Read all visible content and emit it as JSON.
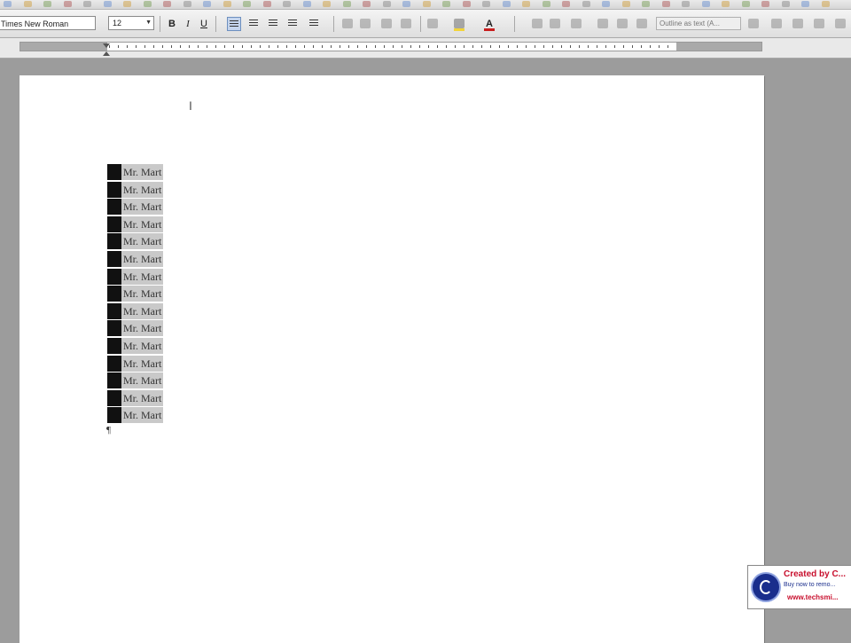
{
  "toolbar": {
    "font_name": "Times New Roman",
    "font_size": "12",
    "style_box_text": "Outline as text (A..."
  },
  "document": {
    "line_text": "Mr. Mart",
    "line_count": 15,
    "paragraph_mark": "¶"
  },
  "watermark": {
    "title": "Created by C...",
    "subtitle": "Buy now to remo...",
    "url": "www.techsmi..."
  },
  "colors": {
    "highlight_color": "#f2d43a",
    "font_color": "#c81e1e",
    "selection": "#111111"
  }
}
